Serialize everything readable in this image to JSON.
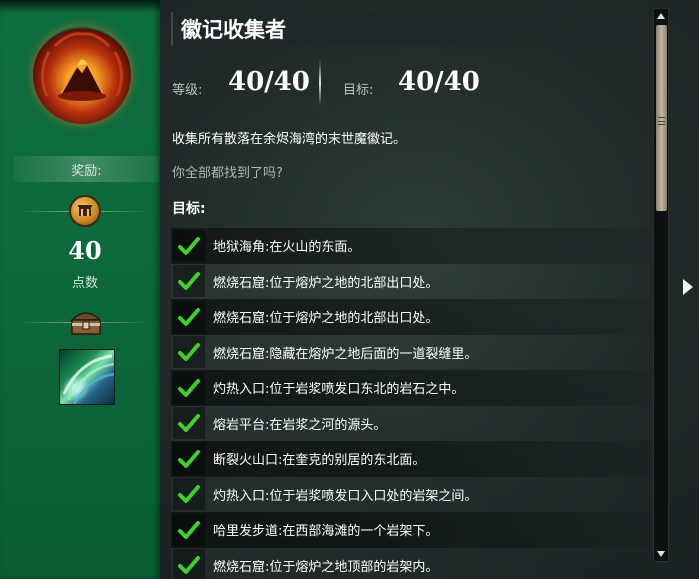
{
  "achievement": {
    "title": "徽记收集者",
    "level_label": "等级:",
    "level_value": "40/40",
    "goal_label": "目标:",
    "goal_value": "40/40",
    "description": "收集所有散落在余烬海湾的末世魔徽记。",
    "flavor": "你全部都找到了吗?",
    "objectives_label": "目标:"
  },
  "rewards": {
    "label": "奖励:",
    "points_value": "40",
    "points_label": "点数",
    "icons": [
      "achievement-point-icon",
      "chest-icon",
      "item-reward-icon"
    ]
  },
  "objectives": [
    {
      "text": "地狱海角:在火山的东面。",
      "done": true
    },
    {
      "text": "燃烧石窟:位于熔炉之地的北部出口处。",
      "done": true
    },
    {
      "text": "燃烧石窟:位于熔炉之地的北部出口处。",
      "done": true
    },
    {
      "text": "燃烧石窟:隐藏在熔炉之地后面的一道裂缝里。",
      "done": true
    },
    {
      "text": "灼热入口:位于岩浆喷发口东北的岩石之中。",
      "done": true
    },
    {
      "text": "熔岩平台:在岩浆之河的源头。",
      "done": true
    },
    {
      "text": "断裂火山口:在奎克的别居的东北面。",
      "done": true
    },
    {
      "text": "灼热入口:位于岩浆喷发口入口处的岩架之间。",
      "done": true
    },
    {
      "text": "哈里发步道:在西部海滩的一个岩架下。",
      "done": true
    },
    {
      "text": "燃烧石窟:位于熔炉之地顶部的岩架内。",
      "done": true
    }
  ],
  "colors": {
    "panel_green": "#0c6a3c",
    "check_green": "#3fd12a",
    "text_white": "#ffffff",
    "muted_text": "#aeb8b5"
  }
}
